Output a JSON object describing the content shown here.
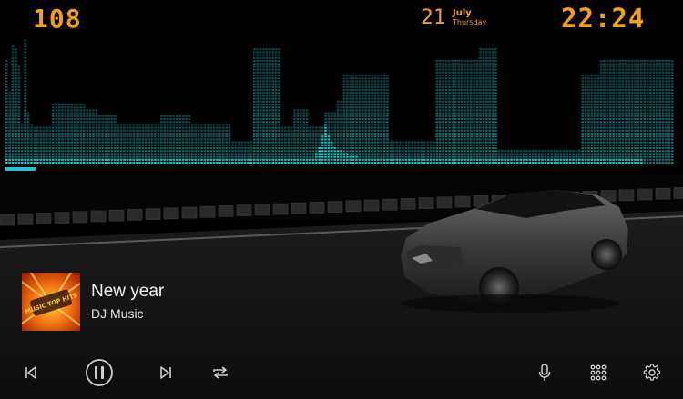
{
  "status": {
    "speed": "108",
    "date_day": "21",
    "date_month": "July",
    "date_weekday": "Thursday",
    "clock": "22:24"
  },
  "visualizer": {
    "color": "#1ec9cf",
    "levels": [
      0.78,
      0.55,
      0.9,
      0.88,
      0.75,
      0.3,
      0.95,
      0.4,
      0.3,
      0.28,
      0.28,
      0.28,
      0.28,
      0.28,
      0.28,
      0.45,
      0.45,
      0.45,
      0.45,
      0.45,
      0.45,
      0.45,
      0.45,
      0.45,
      0.45,
      0.45,
      0.42,
      0.42,
      0.42,
      0.42,
      0.38,
      0.38,
      0.38,
      0.38,
      0.38,
      0.38,
      0.3,
      0.3,
      0.3,
      0.3,
      0.3,
      0.3,
      0.3,
      0.3,
      0.3,
      0.3,
      0.3,
      0.3,
      0.3,
      0.3,
      0.38,
      0.38,
      0.38,
      0.38,
      0.38,
      0.38,
      0.38,
      0.38,
      0.38,
      0.38,
      0.3,
      0.3,
      0.3,
      0.3,
      0.3,
      0.3,
      0.3,
      0.3,
      0.3,
      0.3,
      0.3,
      0.3,
      0.3,
      0.18,
      0.18,
      0.18,
      0.18,
      0.18,
      0.18,
      0.18,
      0.88,
      0.88,
      0.88,
      0.88,
      0.88,
      0.88,
      0.88,
      0.88,
      0.88,
      0.28,
      0.28,
      0.28,
      0.28,
      0.42,
      0.42,
      0.42,
      0.42,
      0.42,
      0.28,
      0.28,
      0.28,
      0.28,
      0.28,
      0.4,
      0.4,
      0.4,
      0.4,
      0.48,
      0.48,
      0.68,
      0.68,
      0.68,
      0.68,
      0.68,
      0.68,
      0.68,
      0.68,
      0.68,
      0.68,
      0.68,
      0.68,
      0.68,
      0.68,
      0.68,
      0.18,
      0.18,
      0.18,
      0.18,
      0.18,
      0.18,
      0.18,
      0.18,
      0.18,
      0.18,
      0.18,
      0.18,
      0.18,
      0.18,
      0.18,
      0.78,
      0.78,
      0.78,
      0.78,
      0.78,
      0.78,
      0.78,
      0.78,
      0.78,
      0.78,
      0.78,
      0.78,
      0.78,
      0.78,
      0.88,
      0.88,
      0.88,
      0.88,
      0.88,
      0.88,
      0.1,
      0.1,
      0.1,
      0.1,
      0.1,
      0.1,
      0.1,
      0.1,
      0.1,
      0.1,
      0.1,
      0.1,
      0.1,
      0.1,
      0.1,
      0.1,
      0.1,
      0.1,
      0.1,
      0.1,
      0.1,
      0.1,
      0.1,
      0.1,
      0.1,
      0.1,
      0.1,
      0.68,
      0.68,
      0.68,
      0.68,
      0.68,
      0.68,
      0.78,
      0.78,
      0.78,
      0.78,
      0.78,
      0.78,
      0.78,
      0.78,
      0.78,
      0.78,
      0.78,
      0.78,
      0.78,
      0.78,
      0.78,
      0.78,
      0.78,
      0.78,
      0.78,
      0.78,
      0.78,
      0.78,
      0.78,
      0.78
    ],
    "accent_levels": [
      0.05,
      0.05,
      0.05,
      0.05,
      0.05,
      0.05,
      0.05,
      0.05,
      0.05,
      0.05,
      0.05,
      0.05,
      0.05,
      0.05,
      0.05,
      0.05,
      0.05,
      0.05,
      0.05,
      0.05,
      0.05,
      0.05,
      0.05,
      0.05,
      0.05,
      0.05,
      0.05,
      0.05,
      0.05,
      0.05,
      0.05,
      0.05,
      0.05,
      0.05,
      0.05,
      0.05,
      0.05,
      0.05,
      0.05,
      0.05,
      0.05,
      0.05,
      0.05,
      0.05,
      0.05,
      0.05,
      0.05,
      0.05,
      0.05,
      0.05,
      0.05,
      0.05,
      0.05,
      0.05,
      0.05,
      0.05,
      0.05,
      0.05,
      0.05,
      0.05,
      0.05,
      0.05,
      0.05,
      0.05,
      0.05,
      0.05,
      0.05,
      0.05,
      0.05,
      0.05,
      0.05,
      0.05,
      0.05,
      0.05,
      0.05,
      0.05,
      0.05,
      0.05,
      0.05,
      0.05,
      0.05,
      0.05,
      0.05,
      0.05,
      0.05,
      0.05,
      0.05,
      0.05,
      0.05,
      0.05,
      0.05,
      0.05,
      0.05,
      0.05,
      0.05,
      0.05,
      0.05,
      0.05,
      0.05,
      0.05,
      0.08,
      0.14,
      0.22,
      0.3,
      0.22,
      0.17,
      0.14,
      0.12,
      0.1,
      0.09,
      0.08,
      0.07,
      0.06,
      0.06,
      0.05,
      0.05,
      0.05,
      0.05,
      0.05,
      0.05,
      0.05,
      0.05,
      0.05,
      0.05,
      0.05,
      0.05,
      0.05,
      0.05,
      0.05,
      0.05,
      0.05,
      0.05,
      0.05,
      0.05,
      0.05,
      0.05,
      0.05,
      0.05,
      0.05,
      0.05,
      0.05,
      0.05,
      0.05,
      0.05,
      0.05,
      0.05,
      0.05,
      0.05,
      0.05,
      0.05,
      0.05,
      0.05,
      0.05,
      0.05,
      0.05,
      0.05,
      0.05,
      0.05,
      0.05,
      0.05,
      0.05,
      0.05,
      0.05,
      0.05,
      0.05,
      0.05,
      0.05,
      0.05,
      0.05,
      0.05,
      0.05,
      0.05,
      0.05,
      0.05,
      0.05,
      0.05,
      0.05,
      0.05,
      0.05,
      0.05,
      0.05,
      0.05,
      0.05,
      0.05,
      0.05,
      0.05,
      0.05,
      0.05,
      0.05,
      0.05,
      0.05,
      0.05,
      0.05,
      0.05,
      0.05,
      0.05,
      0.05,
      0.05,
      0.05,
      0.05,
      0.05,
      0.05,
      0.05,
      0.05,
      0.05,
      0.05
    ],
    "progress": 0.045
  },
  "now_playing": {
    "title": "New year",
    "artist": "DJ Music",
    "album_text": "MUSIC TOP HITS"
  },
  "controls": {
    "left": [
      {
        "name": "previous-track-button",
        "icon": "skip-previous-icon"
      },
      {
        "name": "pause-button",
        "icon": "pause-icon"
      },
      {
        "name": "next-track-button",
        "icon": "skip-next-icon"
      },
      {
        "name": "repeat-button",
        "icon": "repeat-icon"
      }
    ],
    "right": [
      {
        "name": "voice-button",
        "icon": "microphone-icon"
      },
      {
        "name": "apps-button",
        "icon": "apps-grid-icon"
      },
      {
        "name": "settings-button",
        "icon": "gear-icon"
      }
    ]
  },
  "colors": {
    "accent": "#f0a020",
    "visualizer": "#1ec9cf",
    "controls": "#cfcfcf"
  }
}
